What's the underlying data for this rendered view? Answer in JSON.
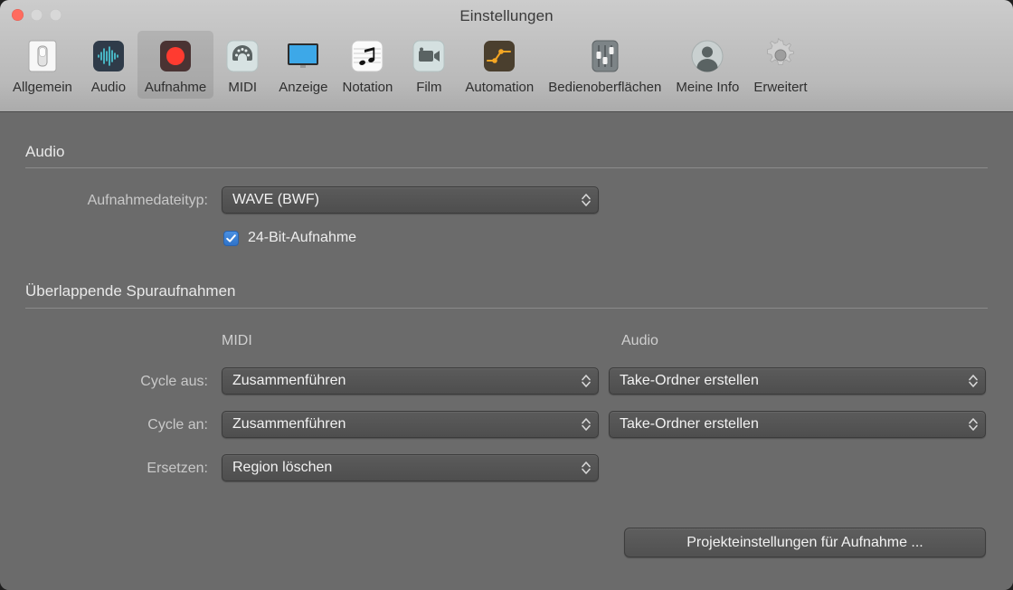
{
  "window": {
    "title": "Einstellungen",
    "traffic_lights": [
      {
        "name": "close",
        "color": "#ff6b5e"
      },
      {
        "name": "minimize",
        "color": "#d8d8d8"
      },
      {
        "name": "maximize",
        "color": "#d8d8d8"
      }
    ]
  },
  "toolbar": {
    "selected": "Aufnahme",
    "tabs": [
      {
        "label": "Allgemein",
        "icon": "toggle-switch-icon"
      },
      {
        "label": "Audio",
        "icon": "waveform-icon"
      },
      {
        "label": "Aufnahme",
        "icon": "record-circle-icon"
      },
      {
        "label": "MIDI",
        "icon": "midi-din-icon"
      },
      {
        "label": "Anzeige",
        "icon": "display-monitor-icon"
      },
      {
        "label": "Notation",
        "icon": "music-note-icon"
      },
      {
        "label": "Film",
        "icon": "movie-camera-icon"
      },
      {
        "label": "Automation",
        "icon": "automation-curve-icon"
      },
      {
        "label": "Bedienoberflächen",
        "icon": "faders-icon"
      },
      {
        "label": "Meine Info",
        "icon": "user-avatar-icon"
      },
      {
        "label": "Erweitert",
        "icon": "gear-icon"
      }
    ]
  },
  "sections": {
    "audio": {
      "title": "Audio",
      "file_type_label": "Aufnahmedateityp:",
      "file_type_value": "WAVE (BWF)",
      "bit24_label": "24-Bit-Aufnahme",
      "bit24_checked": true
    },
    "overlapping": {
      "title": "Überlappende Spuraufnahmen",
      "col_midi": "MIDI",
      "col_audio": "Audio",
      "rows": [
        {
          "label": "Cycle aus:",
          "midi": "Zusammenführen",
          "audio": "Take-Ordner erstellen"
        },
        {
          "label": "Cycle an:",
          "midi": "Zusammenführen",
          "audio": "Take-Ordner erstellen"
        },
        {
          "label": "Ersetzen:",
          "midi": "Region löschen",
          "audio": null
        }
      ]
    }
  },
  "footer": {
    "project_settings_button": "Projekteinstellungen für Aufnahme ..."
  },
  "colors": {
    "content_bg": "#6b6b6b",
    "chrome_bg": "#c4c4c4",
    "checkbox_accent": "#3a7fd5",
    "record_red": "#ff3b30",
    "automation_yellow": "#f5a623"
  }
}
